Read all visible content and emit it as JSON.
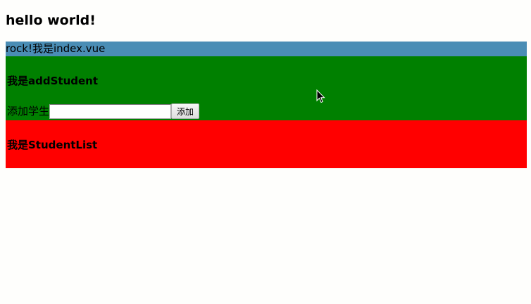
{
  "page": {
    "heading": "hello world!"
  },
  "index": {
    "text": "rock!我是index.vue",
    "background": "#4a8db5"
  },
  "add_student": {
    "title": "我是addStudent",
    "label": "添加学生",
    "input_value": "",
    "button_label": "添加",
    "background": "#008000"
  },
  "student_list": {
    "title": "我是StudentList",
    "background": "#ff0000"
  },
  "cursor": {
    "icon": "mouse-pointer-icon"
  }
}
